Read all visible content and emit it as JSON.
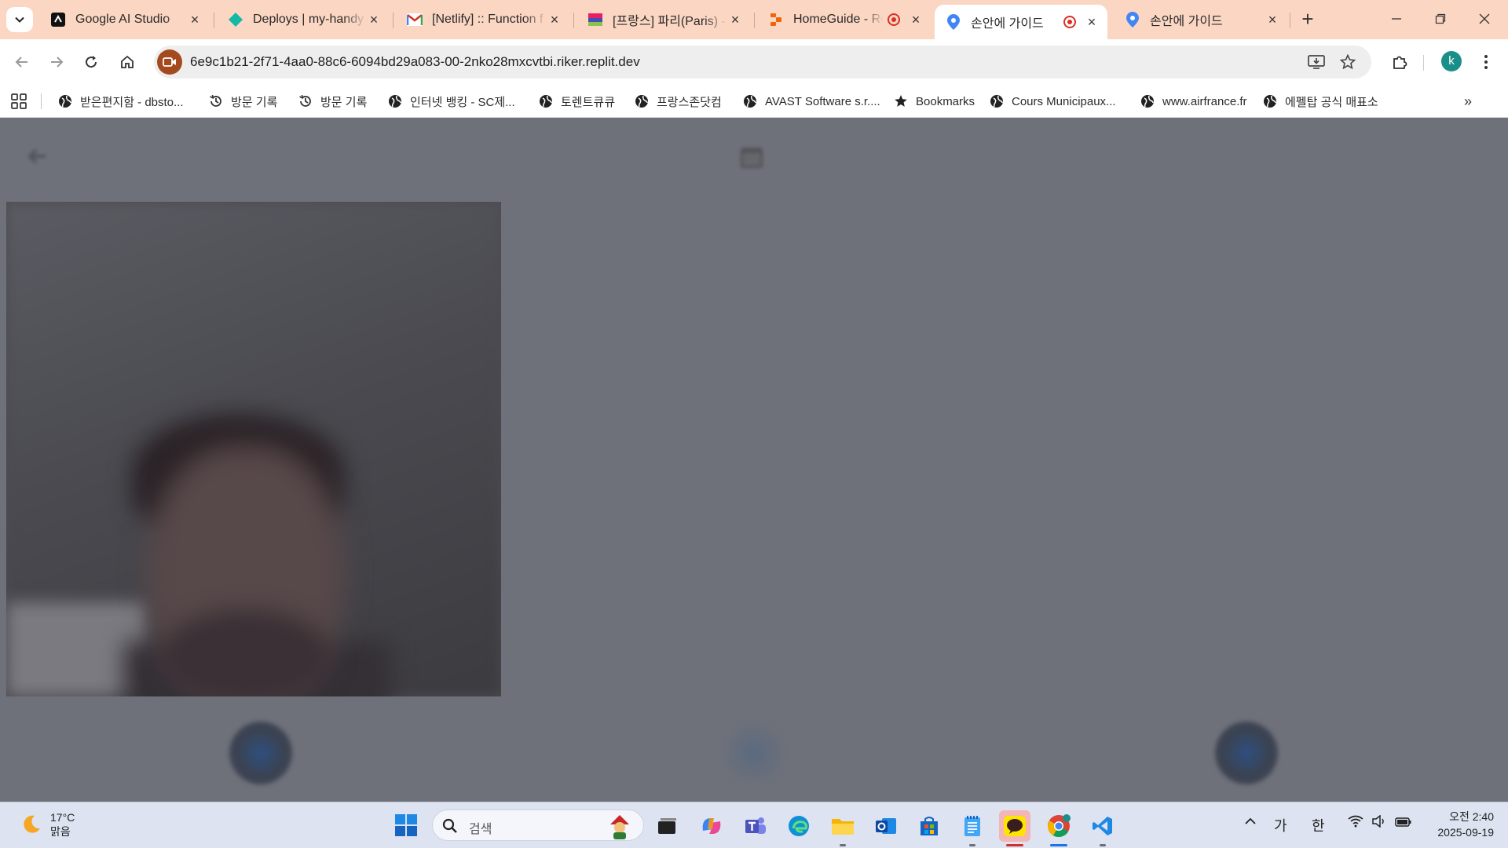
{
  "browser": {
    "tabs": [
      {
        "title": "Google AI Studio",
        "icon": "ai-studio-icon",
        "active": false,
        "recording": false
      },
      {
        "title": "Deploys | my-handy",
        "icon": "netlify-icon",
        "active": false,
        "recording": false
      },
      {
        "title": "[Netlify] :: Function f",
        "icon": "gmail-icon",
        "active": false,
        "recording": false
      },
      {
        "title": "[프랑스] 파리(Paris) -",
        "icon": "travel-site-icon",
        "active": false,
        "recording": false
      },
      {
        "title": "HomeGuide - Re",
        "icon": "replit-icon",
        "active": false,
        "recording": true
      },
      {
        "title": "손안에 가이드",
        "icon": "map-pin-icon",
        "active": true,
        "recording": true
      },
      {
        "title": "손안에 가이드",
        "icon": "map-pin-icon",
        "active": false,
        "recording": false
      }
    ],
    "url": "6e9c1b21-2f71-4aa0-88c6-6094bd29a083-00-2nko28mxcvtbi.riker.replit.dev",
    "profile_initial": "k",
    "bookmarks": [
      {
        "label": "받은편지함 - dbsto...",
        "icon": "globe-icon"
      },
      {
        "label": "방문 기록",
        "icon": "history-icon"
      },
      {
        "label": "방문 기록",
        "icon": "history-icon"
      },
      {
        "label": "인터넷 뱅킹 - SC제...",
        "icon": "globe-icon"
      },
      {
        "label": "토렌트큐큐",
        "icon": "globe-icon"
      },
      {
        "label": "프랑스존닷컴",
        "icon": "globe-icon"
      },
      {
        "label": "AVAST Software s.r....",
        "icon": "globe-icon"
      },
      {
        "label": "Bookmarks",
        "icon": "star-icon"
      },
      {
        "label": "Cours Municipaux...",
        "icon": "globe-icon"
      },
      {
        "label": "www.airfrance.fr",
        "icon": "globe-icon"
      },
      {
        "label": "에펠탑 공식 매표소",
        "icon": "globe-icon"
      }
    ],
    "colors": {
      "tabstrip": "#fbd6c2",
      "accent": "#1a73e8",
      "recording": "#d93025"
    }
  },
  "taskbar": {
    "weather": {
      "temp": "17°C",
      "condition": "맑음"
    },
    "search_placeholder": "검색",
    "tray": {
      "ime_hangul": "가",
      "ime_mode": "한"
    },
    "clock": {
      "time": "오전 2:40",
      "date": "2025-09-19"
    }
  }
}
